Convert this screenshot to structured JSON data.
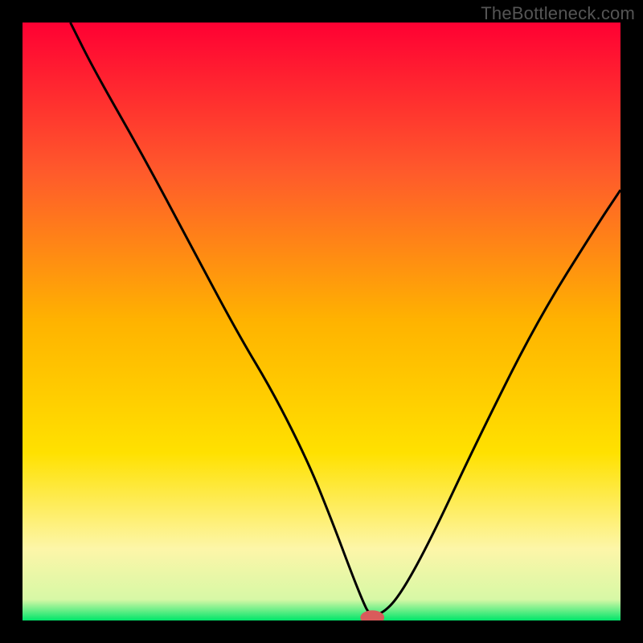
{
  "watermark": "TheBottleneck.com",
  "chart_data": {
    "type": "line",
    "title": "",
    "xlabel": "",
    "ylabel": "",
    "xlim": [
      0,
      100
    ],
    "ylim": [
      0,
      100
    ],
    "grid": false,
    "legend": false,
    "background_gradient": {
      "stops": [
        {
          "pos": 0.0,
          "color": "#ff0033"
        },
        {
          "pos": 0.25,
          "color": "#ff5a2b"
        },
        {
          "pos": 0.5,
          "color": "#ffb300"
        },
        {
          "pos": 0.72,
          "color": "#ffe100"
        },
        {
          "pos": 0.88,
          "color": "#fdf6a8"
        },
        {
          "pos": 0.965,
          "color": "#d7f8a6"
        },
        {
          "pos": 1.0,
          "color": "#00e56a"
        }
      ]
    },
    "series": [
      {
        "name": "bottleneck-curve",
        "x": [
          8,
          12,
          20,
          28,
          36,
          42,
          48,
          52,
          55,
          57,
          58,
          60,
          63,
          68,
          76,
          86,
          96,
          100
        ],
        "values": [
          100,
          92,
          78,
          63,
          48,
          38,
          26,
          16,
          8,
          3,
          1,
          1,
          4,
          13,
          30,
          50,
          66,
          72
        ],
        "color": "#000000",
        "linewidth": 3
      }
    ],
    "marker": {
      "name": "optimal-point",
      "x": 58.5,
      "y": 0.5,
      "color": "#d95b5b",
      "rx": 2.0,
      "ry": 1.2
    }
  }
}
